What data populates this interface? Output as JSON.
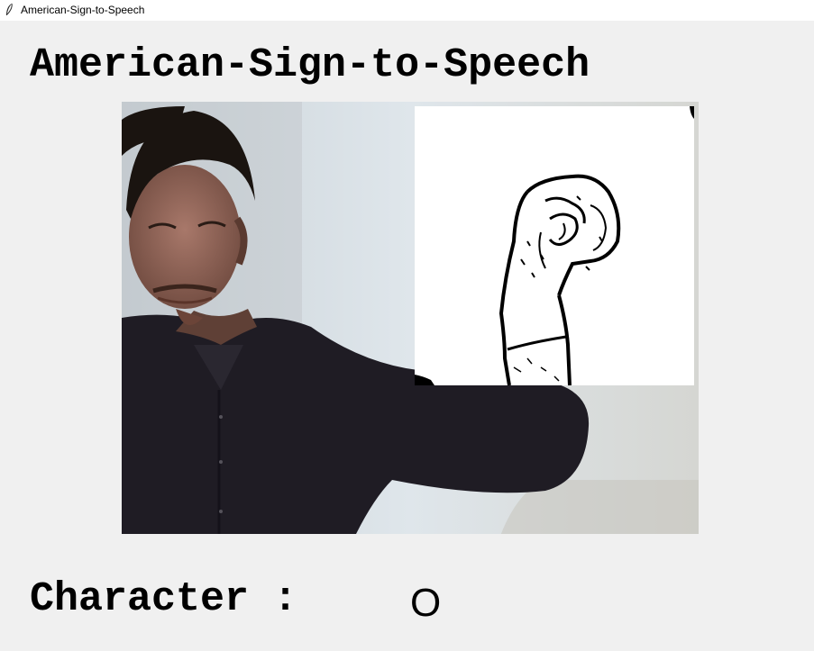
{
  "window": {
    "title": "American-Sign-to-Speech",
    "icon": "feather-icon"
  },
  "heading": "American-Sign-to-Speech",
  "camera": {
    "feed": "webcam-feed",
    "overlay": "processed-hand-image"
  },
  "prediction": {
    "label": "Character :",
    "value": "O"
  }
}
